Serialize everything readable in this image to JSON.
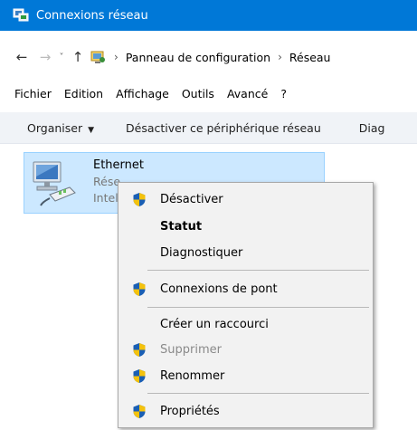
{
  "window": {
    "title": "Connexions réseau"
  },
  "nav": {
    "back_glyph": "←",
    "forward_glyph": "→",
    "dropdown_glyph": "˅",
    "up_glyph": "↑",
    "separator_glyph": "›",
    "breadcrumb": [
      "Panneau de configuration",
      "Réseau"
    ]
  },
  "menubar": [
    "Fichier",
    "Edition",
    "Affichage",
    "Outils",
    "Avancé",
    "?"
  ],
  "commandbar": {
    "organize": "Organiser",
    "organize_caret": "▼",
    "disable": "Désactiver ce périphérique réseau",
    "diagnose": "Diag"
  },
  "adapter": {
    "name": "Ethernet",
    "line2": "Rése",
    "line3": "Intel"
  },
  "context_menu": {
    "items": [
      {
        "label": "Désactiver",
        "icon": "uac-shield-icon"
      },
      {
        "label": "Statut",
        "bold": true
      },
      {
        "label": "Diagnostiquer"
      },
      {
        "label": "Connexions de pont",
        "icon": "uac-shield-icon"
      },
      {
        "label": "Créer un raccourci"
      },
      {
        "label": "Supprimer",
        "icon": "uac-shield-icon",
        "disabled": true
      },
      {
        "label": "Renommer",
        "icon": "uac-shield-icon"
      },
      {
        "label": "Propriétés",
        "icon": "uac-shield-icon"
      }
    ]
  },
  "colors": {
    "titlebar": "#0078d7",
    "selection": "#cce8ff",
    "menu_bg": "#f2f2f2"
  }
}
